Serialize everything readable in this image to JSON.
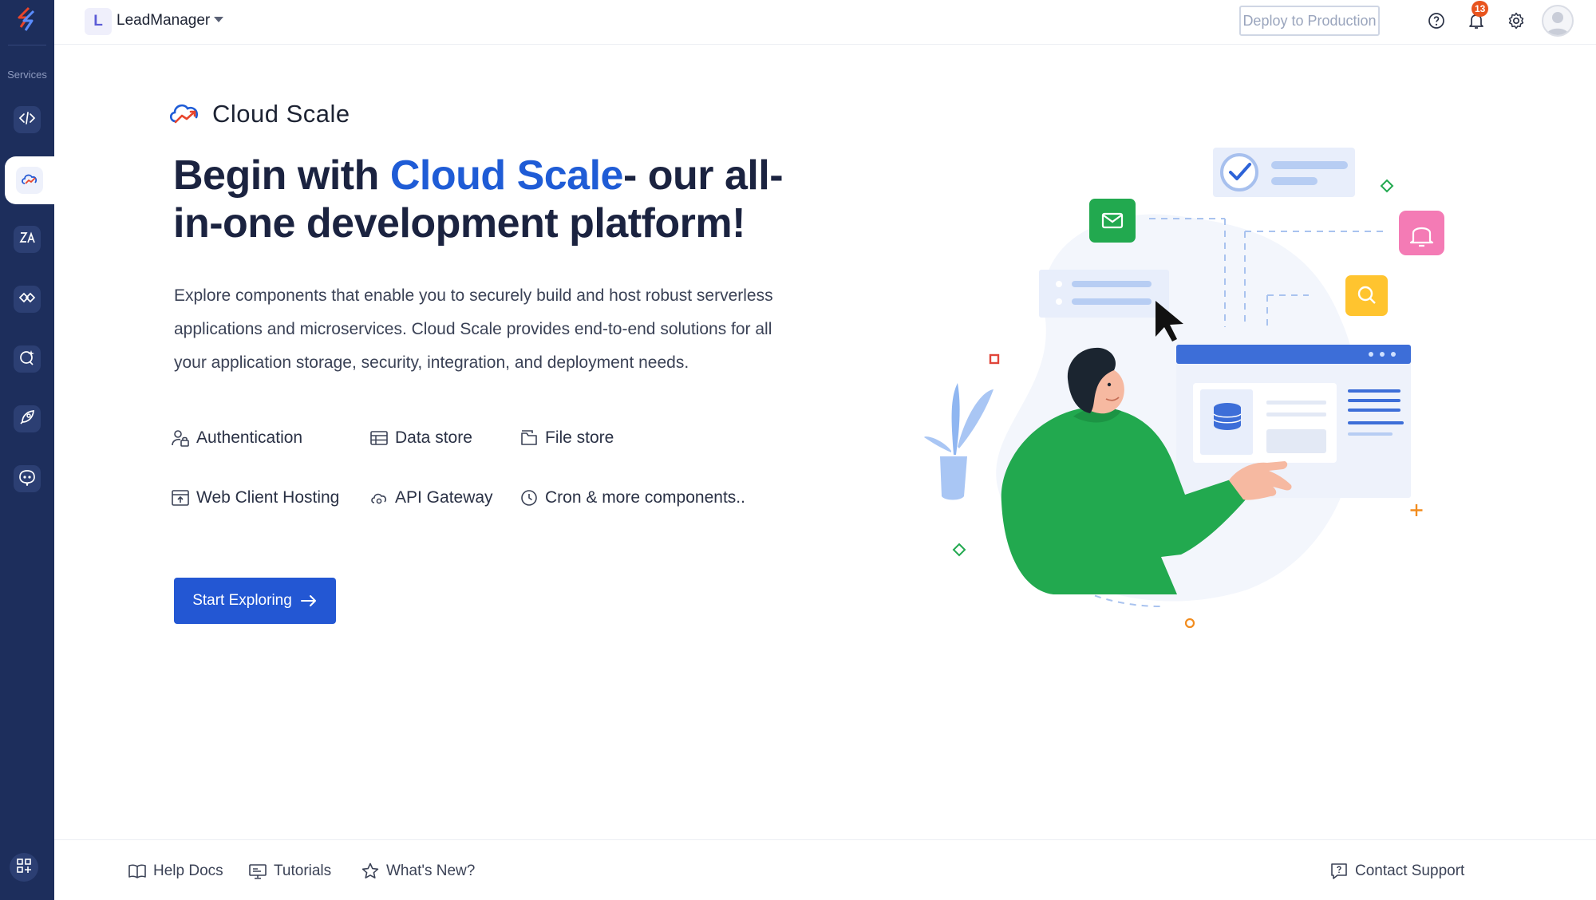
{
  "topbar": {
    "project_initial": "L",
    "project_name": "LeadManager",
    "deploy_label": "Deploy to Production",
    "notification_count": "13"
  },
  "sidebar": {
    "section_title": "Services",
    "items": [
      {
        "icon": "code-icon",
        "active": false
      },
      {
        "icon": "cloud-scale-icon",
        "active": true
      },
      {
        "icon": "integrations-icon",
        "active": false
      },
      {
        "icon": "connect-icon",
        "active": false
      },
      {
        "icon": "ai-sparkle-icon",
        "active": false
      },
      {
        "icon": "rocket-icon",
        "active": false
      },
      {
        "icon": "bot-icon",
        "active": false
      }
    ],
    "bottom_icon": "apps-grid-icon"
  },
  "main": {
    "service_title": "Cloud Scale",
    "hero_before": "Begin with ",
    "hero_highlight": "Cloud Scale",
    "hero_after": "- our all-in-one development platform!",
    "description": "Explore components that enable you to securely build and host robust serverless applications and microservices. Cloud Scale provides end-to-end solutions for all your application storage, security, integration, and deployment needs.",
    "features": [
      {
        "label": "Authentication",
        "icon": "user-lock-icon"
      },
      {
        "label": "Data store",
        "icon": "table-icon"
      },
      {
        "label": "File store",
        "icon": "folder-icon"
      },
      {
        "label": "Web Client Hosting",
        "icon": "upload-window-icon"
      },
      {
        "label": "API Gateway",
        "icon": "cloud-gear-icon"
      },
      {
        "label": "Cron & more components..",
        "icon": "clock-icon"
      }
    ],
    "cta_label": "Start Exploring"
  },
  "footer": {
    "help_docs": "Help Docs",
    "tutorials": "Tutorials",
    "whats_new": "What's New?",
    "contact_support": "Contact Support"
  },
  "colors": {
    "rail": "#1d2e5c",
    "accent": "#2357d3",
    "highlight": "#ffd21e",
    "illustration_green": "#22a94f"
  }
}
